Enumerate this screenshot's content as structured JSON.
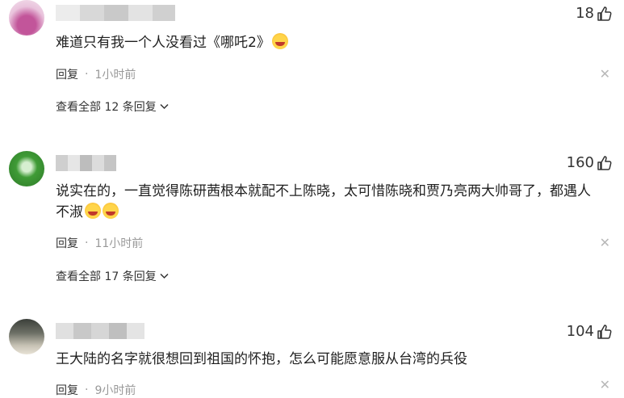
{
  "comments": [
    {
      "text": "难道只有我一个人没看过《哪吒2》",
      "emoji_count": 1,
      "likes": "18",
      "reply_label": "回复",
      "time": "1小时前",
      "more_replies": "查看全部 12 条回复"
    },
    {
      "text_line1": "说实在的，一直觉得陈研茜根本就配不上陈晓，太可惜陈晓和贾乃亮两大帅哥了，都遇人",
      "text_line2": "不淑",
      "emoji_count": 2,
      "likes": "160",
      "reply_label": "回复",
      "time": "11小时前",
      "more_replies": "查看全部 17 条回复"
    },
    {
      "text": "王大陆的名字就很想回到祖国的怀抱，怎么可能愿意服从台湾的兵役",
      "likes": "104",
      "reply_label": "回复",
      "time": "9小时前"
    }
  ],
  "icons": {
    "like": "thumbs-up-icon",
    "close": "close-icon",
    "expand": "chevron-down-icon",
    "emoji": "laughing-tears-emoji-icon"
  },
  "colors": {
    "text": "#1f1f1f",
    "meta": "#999999",
    "close": "#b8b8b8"
  }
}
